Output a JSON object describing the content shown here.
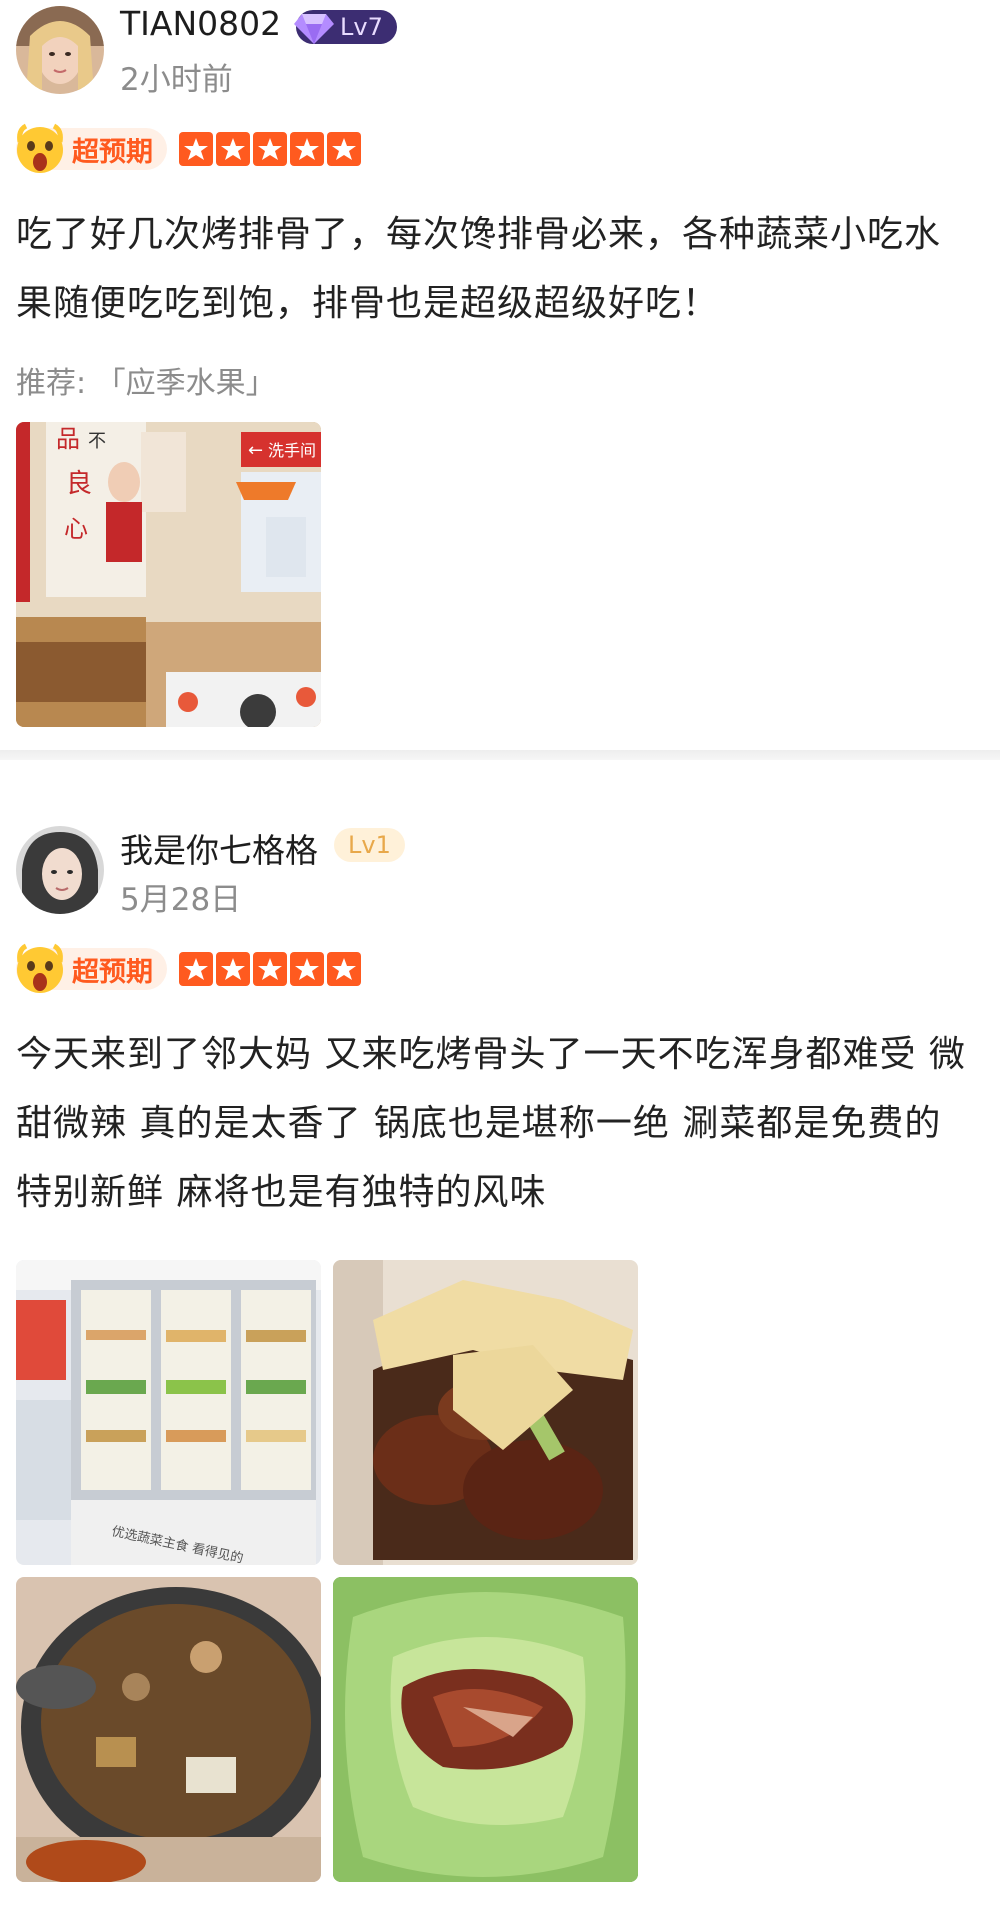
{
  "reviews": [
    {
      "username": "TIAN0802",
      "level": "Lv7",
      "time": "2小时前",
      "rating_label": "超预期",
      "stars": 5,
      "text": "吃了好几次烤排骨了，每次馋排骨必来，各种蔬菜小吃水果随便吃吃到饱，排骨也是超级超级好吃！",
      "recommend_prefix": "推荐: ",
      "recommend_item": "「应季水果」",
      "photos": [
        "restaurant-interior-photo"
      ],
      "photo_text": {
        "poster_big": "品",
        "poster_mid": "不",
        "poster_chars": "良",
        "poster_heart": "心",
        "poster_sign": "←",
        "poster_sign_text": "洗手间"
      }
    },
    {
      "username": "我是你七格格",
      "level": "Lv1",
      "time": "5月28日",
      "rating_label": "超预期",
      "stars": 5,
      "text": "今天来到了邻大妈 又来吃烤骨头了一天不吃浑身都难受 微甜微辣 真的是太香了 锅底也是堪称一绝 涮菜都是免费的 特别新鲜 麻将也是有独特的风味",
      "photos": [
        "fridge-display-photo",
        "grilled-ribs-photo",
        "hotpot-photo",
        "lettuce-meat-photo"
      ],
      "photo_text": {
        "fridge_banner": "优选蔬菜主食  看得见的"
      }
    }
  ],
  "colors": {
    "accent": "#ff5a1f",
    "level_vip_bg": "#3c2d72",
    "level_basic_bg": "#fff1d9",
    "muted_text": "#8c8c8c"
  }
}
